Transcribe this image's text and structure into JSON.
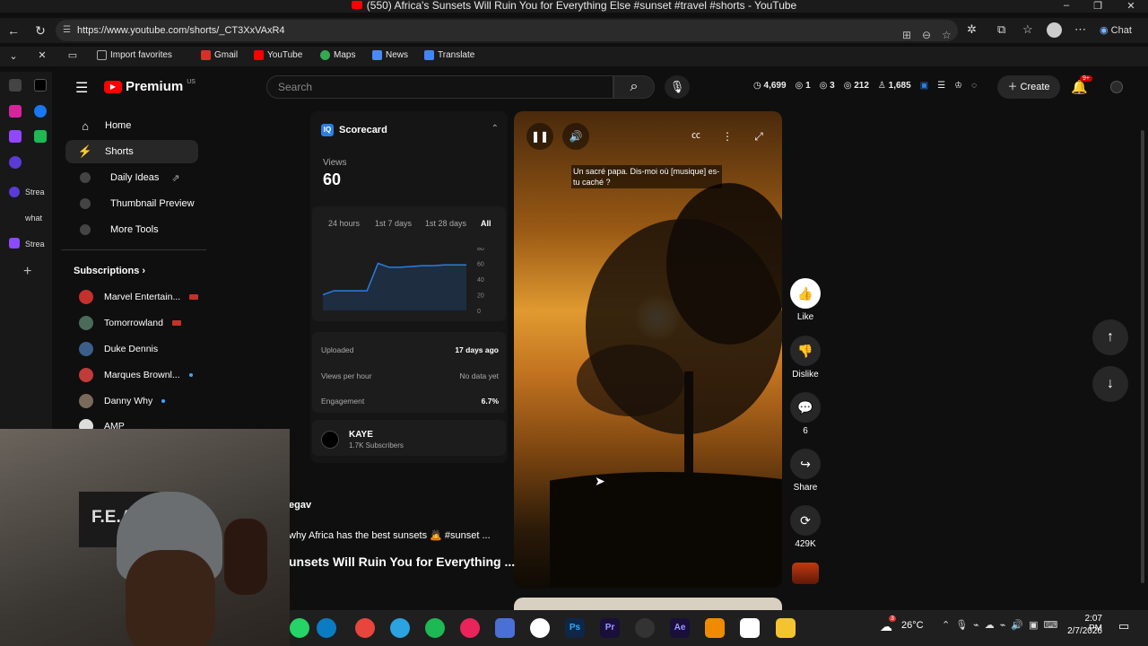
{
  "window": {
    "title": "(550) Africa's Sunsets Will Ruin You for Everything Else #sunset #travel #shorts - YouTube"
  },
  "browser": {
    "url": "https://www.youtube.com/shorts/_CT3XxVAxR4",
    "bookmarks": [
      "Import favorites",
      "Gmail",
      "YouTube",
      "Maps",
      "News",
      "Translate"
    ],
    "chat_label": "Chat",
    "side_apps": [
      "Strea",
      "what",
      "Strea"
    ]
  },
  "yt": {
    "logo": "Premium",
    "region": "US",
    "search_placeholder": "Search",
    "stats": [
      "4,699",
      "1",
      "3",
      "212",
      "1,685"
    ],
    "create_label": "Create",
    "notif_count": "9+",
    "nav": [
      {
        "label": "Home",
        "icon": "home-icon"
      },
      {
        "label": "Shorts",
        "icon": "shorts-icon"
      },
      {
        "label": "Daily Ideas",
        "icon": "tool-icon"
      },
      {
        "label": "Thumbnail Preview",
        "icon": "tool-icon"
      },
      {
        "label": "More Tools",
        "icon": "tool-icon"
      }
    ],
    "subscriptions_label": "Subscriptions",
    "subscriptions": [
      {
        "name": "Marvel Entertain...",
        "color": "#c4302b"
      },
      {
        "name": "Tomorrowland",
        "color": "#4a6b5a"
      },
      {
        "name": "Duke Dennis",
        "color": "#3a5f8a"
      },
      {
        "name": "Marques Brownl...",
        "color": "#c23a3a"
      },
      {
        "name": "Danny Why",
        "color": "#7a6a5a"
      },
      {
        "name": "AMP",
        "color": "#ddd"
      }
    ]
  },
  "scorecard": {
    "title": "Scorecard",
    "views_label": "Views",
    "views_value": "60",
    "tabs": [
      "24 hours",
      "1st 7 days",
      "1st 28 days",
      "All"
    ],
    "chart_ticks": [
      "80",
      "60",
      "40",
      "20",
      "0"
    ],
    "chart_points": [
      20,
      25,
      25,
      25,
      25,
      60,
      55,
      55,
      56,
      57,
      57,
      58,
      58,
      58
    ],
    "metrics": [
      {
        "label": "Uploaded",
        "value": "17 days ago"
      },
      {
        "label": "Views per hour",
        "value": "No data yet"
      },
      {
        "label": "Engagement",
        "value": "6.7%"
      }
    ],
    "channel_name": "KAYE",
    "channel_subs": "1.7K Subscribers"
  },
  "video": {
    "caption": "Un sacré papa. Dis-moi où [musique] es-tu caché ?",
    "channel_partial": "egav",
    "desc": "why Africa has the best sunsets 🙇 #sunset ...",
    "title_partial": "unsets Will Ruin You for Everything ..."
  },
  "actions": [
    {
      "label": "Like",
      "icon": "thumbs-up-icon",
      "glyph": "👍"
    },
    {
      "label": "Dislike",
      "icon": "thumbs-down-icon",
      "glyph": "👎"
    },
    {
      "label": "6",
      "icon": "comment-icon",
      "glyph": "💬"
    },
    {
      "label": "Share",
      "icon": "share-icon",
      "glyph": "↪"
    },
    {
      "label": "429K",
      "icon": "remix-icon",
      "glyph": "⟳"
    }
  ],
  "webcam": {
    "shirt_text": "F.E.A"
  },
  "taskbar": {
    "temp": "26°C",
    "time": "2:07 PM",
    "date": "2/7/2026",
    "weather_badge": "3"
  }
}
